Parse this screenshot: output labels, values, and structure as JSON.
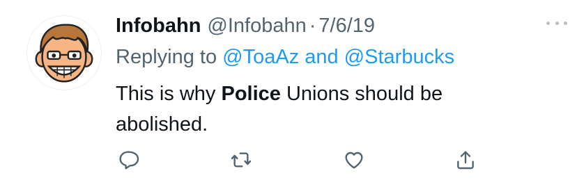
{
  "tweet": {
    "display_name": "Infobahn",
    "handle": "@Infobahn",
    "separator": "·",
    "date": "7/6/19",
    "replying_prefix": "Replying to",
    "reply_mention_1": "@ToaAz",
    "reply_joiner": "and",
    "reply_mention_2": "@Starbucks",
    "body_part_1": "This is why ",
    "body_bold": "Police",
    "body_part_2": " Unions should be abolished."
  },
  "icons": {
    "avatar": "cartoon-face-avatar",
    "more": "more-dots-icon",
    "reply": "reply-icon",
    "retweet": "retweet-icon",
    "like": "heart-icon",
    "share": "share-icon"
  },
  "colors": {
    "text": "#0f1419",
    "secondary": "#536471",
    "link": "#1d9bf0",
    "icon": "#536471"
  }
}
